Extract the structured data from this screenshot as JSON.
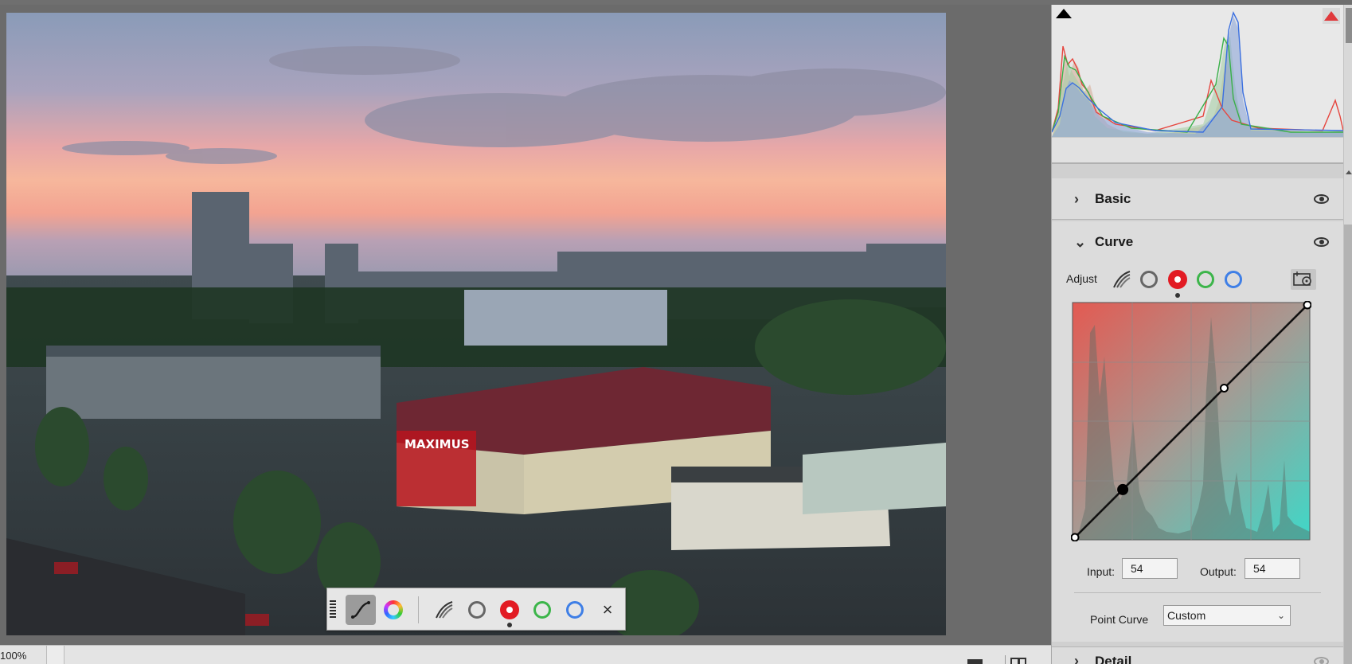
{
  "statusbar": {
    "zoom": "100%"
  },
  "float_toolbar": {
    "tools": [
      {
        "name": "curve-tool",
        "icon": "curve-icon",
        "selected": true
      },
      {
        "name": "color-wheel",
        "icon": "color-wheel-icon"
      }
    ],
    "channels": [
      {
        "name": "rgb",
        "icon": "rgb-channel-icon"
      },
      {
        "name": "luminance",
        "icon": "luminance-ring-icon",
        "color": "#666666"
      },
      {
        "name": "red",
        "icon": "red-dot-icon",
        "color": "#e21b23",
        "active": true
      },
      {
        "name": "green",
        "icon": "green-ring-icon",
        "color": "#3cb54a"
      },
      {
        "name": "blue",
        "icon": "blue-ring-icon",
        "color": "#3f7fe6"
      }
    ],
    "close_label": "×"
  },
  "panel": {
    "sections": {
      "basic": {
        "title": "Basic",
        "expanded": false,
        "chevron": "›"
      },
      "curve": {
        "title": "Curve",
        "expanded": true,
        "chevron": "⌄"
      },
      "detail": {
        "title": "Detail",
        "expanded": false,
        "chevron": "›"
      }
    },
    "curve": {
      "adjust_label": "Adjust",
      "active_channel": "red",
      "input_label": "Input:",
      "input_value": "54",
      "output_label": "Output:",
      "output_value": "54",
      "point_curve_label": "Point Curve",
      "point_curve_value": "Custom",
      "points": [
        [
          0,
          0
        ],
        [
          54,
          54
        ],
        [
          163,
          163
        ],
        [
          255,
          255
        ]
      ],
      "selected_point": 1
    }
  },
  "colors": {
    "red_channel": "#e21b23",
    "green_channel": "#3cb54a",
    "blue_channel": "#3f7fe6"
  }
}
